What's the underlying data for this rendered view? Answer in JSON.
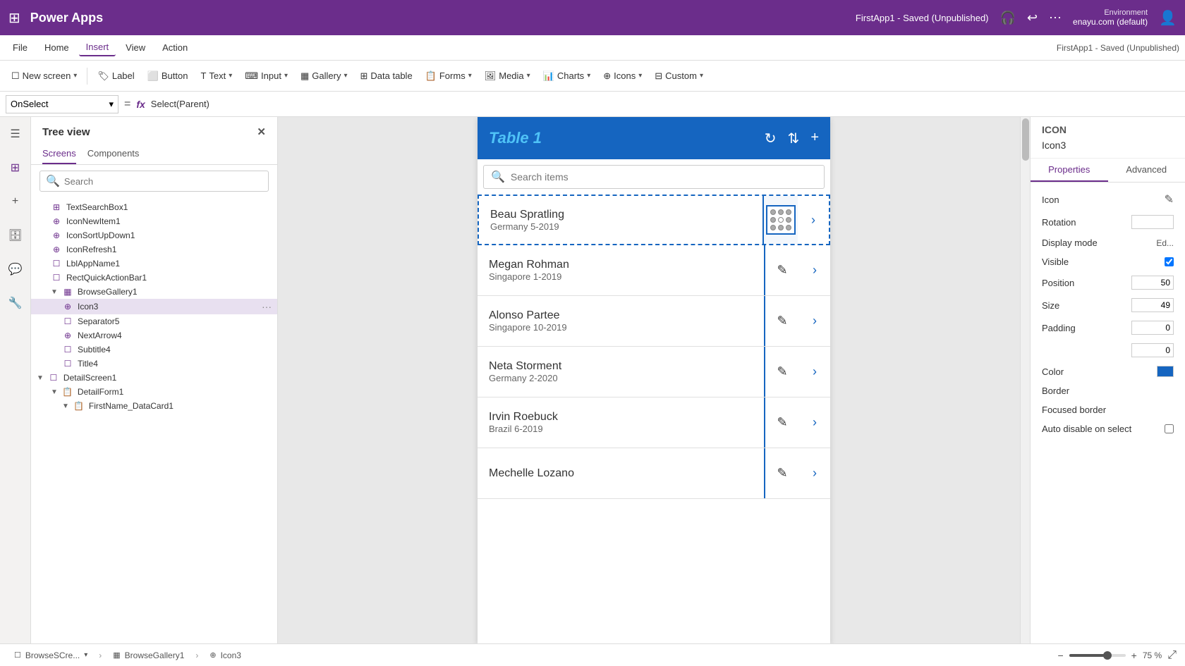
{
  "browser": {
    "url": "as.create.powerapps.com/studio/"
  },
  "topbar": {
    "app_title": "Power Apps",
    "environment_label": "Environment",
    "environment_name": "enayu.com (default)"
  },
  "menubar": {
    "items": [
      "File",
      "Home",
      "Insert",
      "View",
      "Action"
    ],
    "active_item": "Insert",
    "right_text": "FirstApp1 - Saved (Unpublished)"
  },
  "toolbar": {
    "new_screen": "New screen",
    "label": "Label",
    "button": "Button",
    "text": "Text",
    "input": "Input",
    "gallery": "Gallery",
    "data_table": "Data table",
    "forms": "Forms",
    "media": "Media",
    "charts": "Charts",
    "icons": "Icons",
    "custom": "Custom"
  },
  "formula_bar": {
    "property": "OnSelect",
    "formula": "Select(Parent)"
  },
  "tree_view": {
    "title": "Tree view",
    "tabs": [
      "Screens",
      "Components"
    ],
    "active_tab": "Screens",
    "search_placeholder": "Search",
    "items": [
      {
        "id": "TextSearchBox1",
        "label": "TextSearchBox1",
        "indent": 1,
        "icon": "⊞"
      },
      {
        "id": "IconNewItem1",
        "label": "IconNewItem1",
        "indent": 1,
        "icon": "⊕"
      },
      {
        "id": "IconSortUpDown1",
        "label": "IconSortUpDown1",
        "indent": 1,
        "icon": "⊕"
      },
      {
        "id": "IconRefresh1",
        "label": "IconRefresh1",
        "indent": 1,
        "icon": "⊕"
      },
      {
        "id": "LblAppName1",
        "label": "LblAppName1",
        "indent": 1,
        "icon": "☐"
      },
      {
        "id": "RectQuickActionBar1",
        "label": "RectQuickActionBar1",
        "indent": 1,
        "icon": "☐"
      },
      {
        "id": "BrowseGallery1",
        "label": "BrowseGallery1",
        "indent": 1,
        "icon": "▦",
        "expanded": true
      },
      {
        "id": "Icon3",
        "label": "Icon3",
        "indent": 2,
        "icon": "⊕",
        "selected": true
      },
      {
        "id": "Separator5",
        "label": "Separator5",
        "indent": 2,
        "icon": "☐"
      },
      {
        "id": "NextArrow4",
        "label": "NextArrow4",
        "indent": 2,
        "icon": "⊕"
      },
      {
        "id": "Subtitle4",
        "label": "Subtitle4",
        "indent": 2,
        "icon": "☐"
      },
      {
        "id": "Title4",
        "label": "Title4",
        "indent": 2,
        "icon": "☐"
      },
      {
        "id": "DetailScreen1",
        "label": "DetailScreen1",
        "indent": 0,
        "icon": "☐",
        "expanded": true
      },
      {
        "id": "DetailForm1",
        "label": "DetailForm1",
        "indent": 1,
        "icon": "📋",
        "expanded": true
      },
      {
        "id": "FirstName_DataCard1",
        "label": "FirstName_DataCard1",
        "indent": 2,
        "icon": "📋"
      }
    ]
  },
  "canvas": {
    "app_title": "Table 1",
    "search_placeholder": "Search items",
    "gallery_items": [
      {
        "name": "Beau Spratling",
        "sub": "Germany 5-2019",
        "selected": true
      },
      {
        "name": "Megan Rohman",
        "sub": "Singapore 1-2019"
      },
      {
        "name": "Alonso Partee",
        "sub": "Singapore 10-2019"
      },
      {
        "name": "Neta Storment",
        "sub": "Germany 2-2020"
      },
      {
        "name": "Irvin Roebuck",
        "sub": "Brazil 6-2019"
      },
      {
        "name": "Mechelle Lozano",
        "sub": ""
      }
    ]
  },
  "properties_panel": {
    "icon_label": "ICON",
    "icon_name": "Icon3",
    "tabs": [
      "Properties",
      "Advanced"
    ],
    "active_tab": "Properties",
    "props": [
      {
        "label": "Icon",
        "value": ""
      },
      {
        "label": "Rotation",
        "value": ""
      },
      {
        "label": "Display mode",
        "value": "Ed..."
      },
      {
        "label": "Visible",
        "value": ""
      },
      {
        "label": "Position",
        "value": "50"
      },
      {
        "label": "Size",
        "value": "49"
      },
      {
        "label": "Padding",
        "value": "0"
      },
      {
        "label": "",
        "value": "0"
      },
      {
        "label": "Color",
        "value": ""
      },
      {
        "label": "Border",
        "value": ""
      },
      {
        "label": "Focused border",
        "value": ""
      },
      {
        "label": "Auto disable on select",
        "value": ""
      }
    ]
  },
  "status_bar": {
    "breadcrumb_1": "BrowseSCre...",
    "breadcrumb_2": "BrowseGallery1",
    "breadcrumb_3": "Icon3",
    "zoom_level": "75 %"
  }
}
